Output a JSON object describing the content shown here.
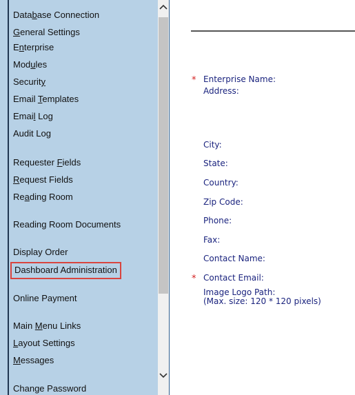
{
  "sidebar": {
    "items": [
      {
        "pre": "Data",
        "ul": "b",
        "post": "ase Connection"
      },
      {
        "pre": "",
        "ul": "G",
        "post": "eneral Settings"
      },
      {
        "pre": "E",
        "ul": "n",
        "post": "terprise"
      },
      {
        "pre": "Mod",
        "ul": "u",
        "post": "les"
      },
      {
        "pre": "Securit",
        "ul": "y",
        "post": ""
      },
      {
        "pre": "Email ",
        "ul": "T",
        "post": "emplates"
      },
      {
        "pre": "Emai",
        "ul": "l",
        "post": " Log"
      },
      {
        "pre": "Audit Log",
        "ul": "",
        "post": ""
      },
      {
        "pre": "Requester ",
        "ul": "F",
        "post": "ields"
      },
      {
        "pre": "",
        "ul": "R",
        "post": "equest Fields"
      },
      {
        "pre": "Re",
        "ul": "a",
        "post": "ding Room"
      },
      {
        "pre": "Reading Room Documents",
        "ul": "",
        "post": ""
      },
      {
        "pre": "Display Order",
        "ul": "",
        "post": ""
      },
      {
        "pre": "Dashboard Administration",
        "ul": "",
        "post": ""
      },
      {
        "pre": "Online Payment",
        "ul": "",
        "post": ""
      },
      {
        "pre": "Main ",
        "ul": "M",
        "post": "enu Links"
      },
      {
        "pre": "",
        "ul": "L",
        "post": "ayout Settings"
      },
      {
        "pre": "",
        "ul": "M",
        "post": "essages"
      },
      {
        "pre": "Change Password",
        "ul": "",
        "post": ""
      }
    ]
  },
  "form": {
    "required_marker": "*",
    "fields": [
      {
        "label": "Enterprise Name:",
        "required": true
      },
      {
        "label": "Address:",
        "required": false
      },
      {
        "label": "City:",
        "required": false
      },
      {
        "label": "State:",
        "required": false
      },
      {
        "label": "Country:",
        "required": false
      },
      {
        "label": "Zip Code:",
        "required": false
      },
      {
        "label": "Phone:",
        "required": false
      },
      {
        "label": "Fax:",
        "required": false
      },
      {
        "label": "Contact Name:",
        "required": false
      },
      {
        "label": "Contact Email:",
        "required": true
      },
      {
        "label": "Image Logo Path:",
        "required": false
      },
      {
        "label": "(Max. size: 120 * 120 pixels)",
        "required": false
      }
    ]
  },
  "colors": {
    "sidebar_bg": "#b7d1e6",
    "selected_border": "#d9443e",
    "label_text": "#1a237e",
    "required_star": "#d32020"
  },
  "icons": {
    "scroll_up": "chevron-up-icon",
    "scroll_down": "chevron-down-icon"
  }
}
